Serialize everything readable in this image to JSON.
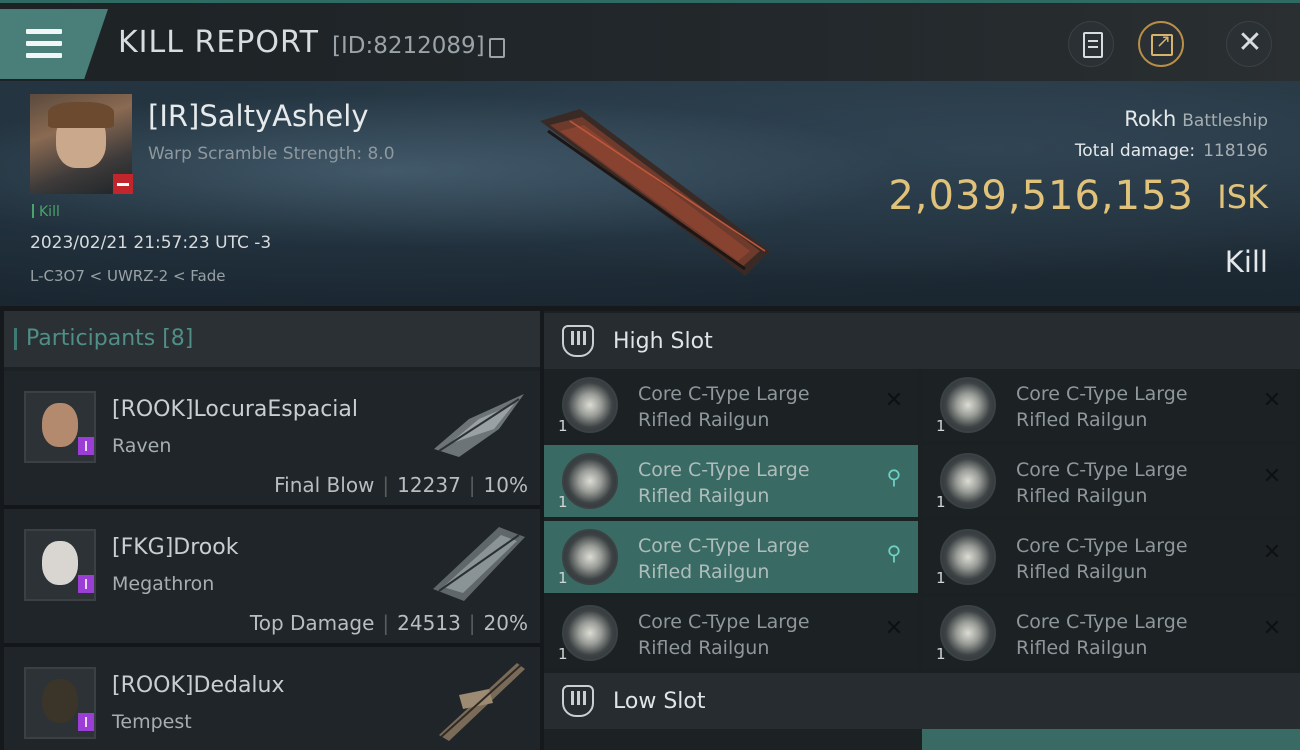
{
  "header": {
    "title": "KILL REPORT",
    "report_id": "[ID:8212089]",
    "icons": [
      "menu-icon",
      "copy-icon",
      "notes-icon",
      "share-icon",
      "close-icon"
    ]
  },
  "victim": {
    "name": "[IR]SaltyAshely",
    "warp_scramble": "Warp Scramble Strength: 8.0",
    "tag": "Kill",
    "time": "2023/02/21 21:57:23 UTC -3",
    "location": "L-C3O7 < UWRZ-2 < Fade",
    "ship": "Rokh",
    "ship_class": "Battleship",
    "total_damage_label": "Total damage:",
    "total_damage": "118196",
    "isk_value": "2,039,516,153",
    "isk_unit": "ISK",
    "result": "Kill"
  },
  "participants": {
    "title": "Participants [8]",
    "rows": [
      {
        "name": "[ROOK]LocuraEspacial",
        "ship": "Raven",
        "role": "Final Blow",
        "damage": "12237",
        "percent": "10%"
      },
      {
        "name": "[FKG]Drook",
        "ship": "Megathron",
        "role": "Top Damage",
        "damage": "24513",
        "percent": "20%"
      },
      {
        "name": "[ROOK]Dedalux",
        "ship": "Tempest"
      }
    ]
  },
  "fitting": {
    "high_slot_title": "High Slot",
    "low_slot_title": "Low Slot",
    "high_modules": [
      {
        "name_line1": "Core C-Type Large",
        "name_line2": "Rifled Railgun",
        "qty": "1",
        "status": "destroyed"
      },
      {
        "name_line1": "Core C-Type Large",
        "name_line2": "Rifled Railgun",
        "qty": "1",
        "status": "destroyed"
      },
      {
        "name_line1": "Core C-Type Large",
        "name_line2": "Rifled Railgun",
        "qty": "1",
        "status": "dropped"
      },
      {
        "name_line1": "Core C-Type Large",
        "name_line2": "Rifled Railgun",
        "qty": "1",
        "status": "destroyed"
      },
      {
        "name_line1": "Core C-Type Large",
        "name_line2": "Rifled Railgun",
        "qty": "1",
        "status": "dropped"
      },
      {
        "name_line1": "Core C-Type Large",
        "name_line2": "Rifled Railgun",
        "qty": "1",
        "status": "destroyed"
      },
      {
        "name_line1": "Core C-Type Large",
        "name_line2": "Rifled Railgun",
        "qty": "1",
        "status": "destroyed"
      },
      {
        "name_line1": "Core C-Type Large",
        "name_line2": "Rifled Railgun",
        "qty": "1",
        "status": "destroyed"
      }
    ],
    "symbols": {
      "destroyed": "✕",
      "dropped": "⚲"
    }
  },
  "colors": {
    "accent": "#4a7f79",
    "isk_gold": "#e0c27a",
    "selected_module": "#3a6a64",
    "negative_standing": "#c0262b",
    "corp_badge": "#9b3ed6"
  }
}
